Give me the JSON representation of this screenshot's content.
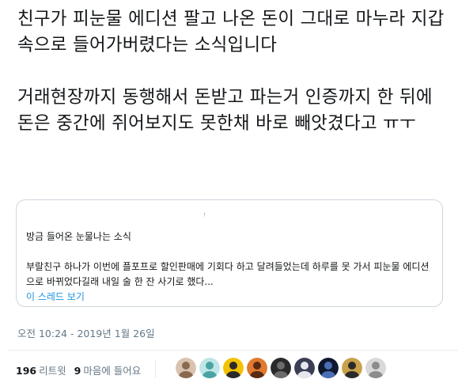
{
  "tweet": {
    "paragraph_1": "친구가 피눈물 에디션 팔고 나온 돈이 그대로 마누라 지갑속으로 들어가버렸다는 소식입니다",
    "paragraph_2": "거래현장까지 동행해서 돈받고 파는거 인증까지 한 뒤에 돈은 중간에 쥐어보지도 못한채 바로 빼앗겼다고 ㅠㅜ"
  },
  "quote": {
    "author_glyph": "ꜝ",
    "title": "방금 들어온 눈물나는 소식",
    "body": "부랄친구 하나가 이번에 플포프로 할인판매에 기회다 하고 달려들었는데 하루를 못 가서 피눈물 에디션으로 바뀌었다길래 내일 술 한 잔 사기로 했다...",
    "thread_link": "이 스레드 보기"
  },
  "timestamp": "오전 10:24 - 2019년 1월 26일",
  "stats": {
    "retweets_count": "196",
    "retweets_label": "리트윗",
    "likes_count": "9",
    "likes_label": "마음에 들어요"
  },
  "likers": [
    {
      "name": "liker-avatar-1",
      "colors": [
        "#d9c3b0",
        "#8a6a4f"
      ]
    },
    {
      "name": "liker-avatar-2",
      "colors": [
        "#bfe6e6",
        "#4aa3a3"
      ]
    },
    {
      "name": "liker-avatar-3",
      "colors": [
        "#f2c200",
        "#2b2b2b"
      ]
    },
    {
      "name": "liker-avatar-4",
      "colors": [
        "#e07a2e",
        "#5a2a12"
      ]
    },
    {
      "name": "liker-avatar-5",
      "colors": [
        "#2a2a2a",
        "#6b6b6b"
      ]
    },
    {
      "name": "liker-avatar-6",
      "colors": [
        "#3a3f55",
        "#e6e6f0"
      ]
    },
    {
      "name": "liker-avatar-7",
      "colors": [
        "#101830",
        "#4b6fb5"
      ]
    },
    {
      "name": "liker-avatar-8",
      "colors": [
        "#c9a24a",
        "#2b2b2b"
      ]
    },
    {
      "name": "liker-avatar-9",
      "colors": [
        "#d9d9d9",
        "#8c8c8c"
      ]
    }
  ]
}
